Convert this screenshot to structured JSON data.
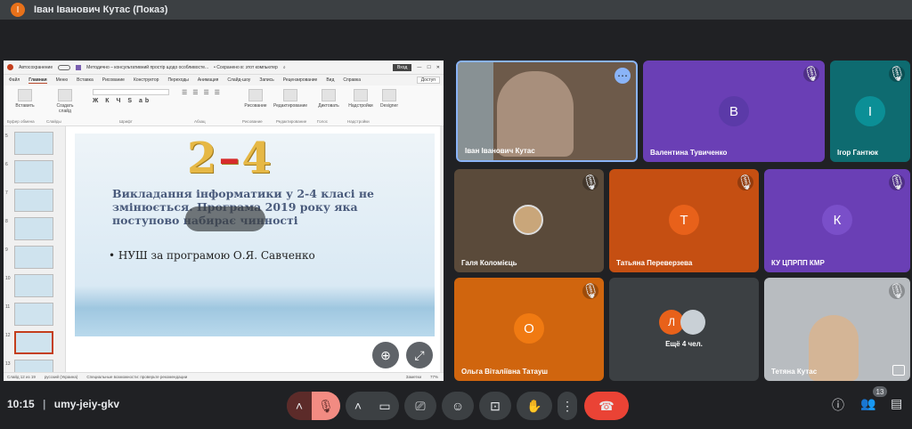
{
  "presenter_bar": {
    "avatar_letter": "I",
    "title": "Іван Іванович Кутас (Показ)"
  },
  "shared_screen": {
    "qa": {
      "autosave": "Автосохранение",
      "doc_title": "Методично – консультативний простір щодо особливосте...",
      "saved": "• Сохранено в: этот компьютер",
      "sign_in": "Вход"
    },
    "tabs": [
      "Файл",
      "Главная",
      "Меню",
      "Вставка",
      "Рисование",
      "Конструктор",
      "Переходы",
      "Анимация",
      "Слайд-шоу",
      "Запись",
      "Рецензирование",
      "Вид",
      "Справка"
    ],
    "active_tab": "Главная",
    "access": "Доступ",
    "ribbon_groups": [
      "Буфер обмена",
      "Слайды",
      "Шрифт",
      "Абзац",
      "Рисование",
      "Редактирование",
      "Голос",
      "Надстройки"
    ],
    "ribbon_buttons": {
      "paste": "Вставить",
      "create_slide": "Создать слайд",
      "drawing": "Рисование",
      "editing": "Редактирование",
      "dictate": "Диктовать",
      "addins": "Надстройки",
      "designer": "Designer"
    },
    "thumb_numbers": [
      "5",
      "6",
      "7",
      "8",
      "9",
      "10",
      "11",
      "12",
      "13"
    ],
    "slide": {
      "big_left": "2",
      "big_dash": "–",
      "big_right": "4",
      "heading": "Викладання інформатики у 2-4 класі не змінюється. Програма 2019 року яка поступово набирає чинності",
      "bullet": "• НУШ за програмою О.Я. Савченко"
    },
    "status": {
      "slide": "Слайд 12 из 19",
      "lang": "русский (Украина)",
      "access": "Специальные возможности: проверьте рекомендации",
      "notes": "Заметки",
      "zoom": "77%"
    }
  },
  "participants": [
    {
      "name": "Іван Іванович Кутас",
      "type": "video"
    },
    {
      "name": "Валентина Тувиченко",
      "letter": "В",
      "color": "#5b3aa8",
      "bg": "#6a3fb5"
    },
    {
      "name": "Ігор Гантюк",
      "letter": "І",
      "color": "#0b8f96",
      "bg": "#0e6b70"
    },
    {
      "name": "Галя Коломієць",
      "type": "photo-avatar",
      "bg": "#5a4a3a"
    },
    {
      "name": "Татьяна Переверзева",
      "letter": "Т",
      "color": "#e8611a",
      "bg": "#c54f12"
    },
    {
      "name": "КУ ЦПРПП КМР",
      "letter": "К",
      "color": "#7a4fc9",
      "bg": "#6a3fb5"
    },
    {
      "name": "Ольга Віталіївна Татауш",
      "letter": "О",
      "color": "#f07a12",
      "bg": "#d0650e"
    },
    {
      "name": "Ещё 4 чел.",
      "letter": "Л",
      "color": "#e8611a",
      "bg": "#3c4043"
    },
    {
      "name": "Тетяна Кутас",
      "type": "video"
    }
  ],
  "bottom": {
    "time": "10:15",
    "separator": "|",
    "meeting_code": "umy-jeiy-gkv",
    "people_count": "13"
  },
  "colors": {
    "hangup": "#ea4335",
    "mic_off_bg": "#f28b82",
    "bar_bg": "#3c4043"
  }
}
